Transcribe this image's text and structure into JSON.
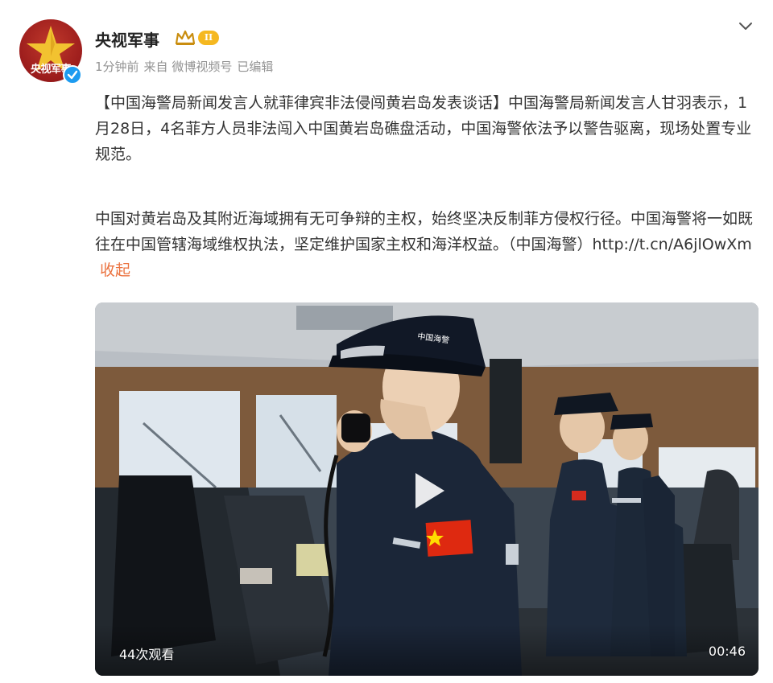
{
  "post": {
    "author": {
      "name": "央视军事",
      "avatar_text": "央视军事",
      "level_badge": "II",
      "verified": true
    },
    "meta": {
      "time": "1分钟前",
      "source": "来自 微博视频号",
      "edited": "已编辑"
    },
    "paragraph1": "【中国海警局新闻发言人就菲律宾非法侵闯黄岩岛发表谈话】中国海警局新闻发言人甘羽表示，1月28日，4名菲方人员非法闯入中国黄岩岛礁盘活动，中国海警依法予以警告驱离，现场处置专业规范。",
    "paragraph2": "中国对黄岩岛及其附近海域拥有无可争辩的主权，始终坚决反制菲方侵权行径。中国海警将一如既往在中国管辖海域维权执法，坚定维护国家主权和海洋权益。（中国海警）",
    "link": "http://t.cn/A6jlOwXm",
    "collapse_label": "收起"
  },
  "video": {
    "views": "44次观看",
    "duration": "00:46",
    "cap_text": "中国海警"
  },
  "colors": {
    "accent_orange": "#eb7340",
    "meta_gray": "#939393",
    "badge_gold": "#f5b820",
    "verified_blue": "#1d9bf0"
  }
}
